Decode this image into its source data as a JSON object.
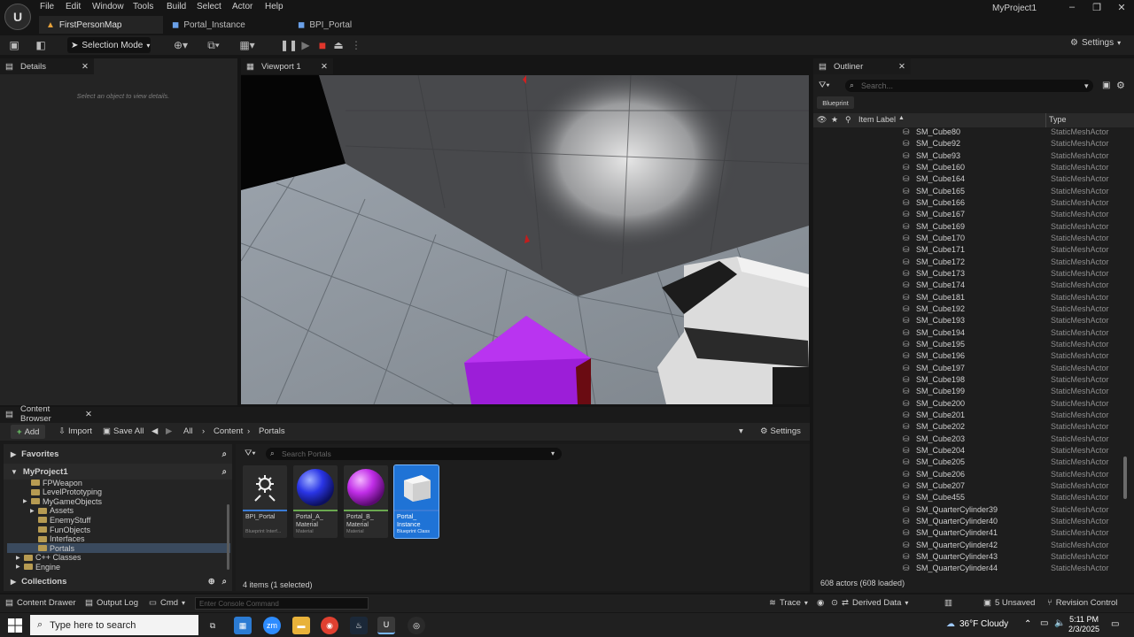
{
  "menu": [
    "File",
    "Edit",
    "Window",
    "Tools",
    "Build",
    "Select",
    "Actor",
    "Help"
  ],
  "project_name": "MyProject1",
  "document_tabs": [
    "FirstPersonMap",
    "Portal_Instance",
    "BPI_Portal"
  ],
  "toolbar": {
    "selection_mode": "Selection Mode",
    "settings": "Settings"
  },
  "details": {
    "tab": "Details",
    "empty_message": "Select an object to view details."
  },
  "viewport": {
    "tab": "Viewport 1"
  },
  "outliner": {
    "tab": "Outliner",
    "search_placeholder": "Search...",
    "filter_chip": "Blueprint",
    "col_label": "Item Label",
    "col_type": "Type",
    "rows": [
      {
        "label": "SM_Cube80",
        "type": "StaticMeshActor"
      },
      {
        "label": "SM_Cube92",
        "type": "StaticMeshActor"
      },
      {
        "label": "SM_Cube93",
        "type": "StaticMeshActor"
      },
      {
        "label": "SM_Cube160",
        "type": "StaticMeshActor"
      },
      {
        "label": "SM_Cube164",
        "type": "StaticMeshActor"
      },
      {
        "label": "SM_Cube165",
        "type": "StaticMeshActor"
      },
      {
        "label": "SM_Cube166",
        "type": "StaticMeshActor"
      },
      {
        "label": "SM_Cube167",
        "type": "StaticMeshActor"
      },
      {
        "label": "SM_Cube169",
        "type": "StaticMeshActor"
      },
      {
        "label": "SM_Cube170",
        "type": "StaticMeshActor"
      },
      {
        "label": "SM_Cube171",
        "type": "StaticMeshActor"
      },
      {
        "label": "SM_Cube172",
        "type": "StaticMeshActor"
      },
      {
        "label": "SM_Cube173",
        "type": "StaticMeshActor"
      },
      {
        "label": "SM_Cube174",
        "type": "StaticMeshActor"
      },
      {
        "label": "SM_Cube181",
        "type": "StaticMeshActor"
      },
      {
        "label": "SM_Cube192",
        "type": "StaticMeshActor"
      },
      {
        "label": "SM_Cube193",
        "type": "StaticMeshActor"
      },
      {
        "label": "SM_Cube194",
        "type": "StaticMeshActor"
      },
      {
        "label": "SM_Cube195",
        "type": "StaticMeshActor"
      },
      {
        "label": "SM_Cube196",
        "type": "StaticMeshActor"
      },
      {
        "label": "SM_Cube197",
        "type": "StaticMeshActor"
      },
      {
        "label": "SM_Cube198",
        "type": "StaticMeshActor"
      },
      {
        "label": "SM_Cube199",
        "type": "StaticMeshActor"
      },
      {
        "label": "SM_Cube200",
        "type": "StaticMeshActor"
      },
      {
        "label": "SM_Cube201",
        "type": "StaticMeshActor"
      },
      {
        "label": "SM_Cube202",
        "type": "StaticMeshActor"
      },
      {
        "label": "SM_Cube203",
        "type": "StaticMeshActor"
      },
      {
        "label": "SM_Cube204",
        "type": "StaticMeshActor"
      },
      {
        "label": "SM_Cube205",
        "type": "StaticMeshActor"
      },
      {
        "label": "SM_Cube206",
        "type": "StaticMeshActor"
      },
      {
        "label": "SM_Cube207",
        "type": "StaticMeshActor"
      },
      {
        "label": "SM_Cube455",
        "type": "StaticMeshActor"
      },
      {
        "label": "SM_QuarterCylinder39",
        "type": "StaticMeshActor"
      },
      {
        "label": "SM_QuarterCylinder40",
        "type": "StaticMeshActor"
      },
      {
        "label": "SM_QuarterCylinder41",
        "type": "StaticMeshActor"
      },
      {
        "label": "SM_QuarterCylinder42",
        "type": "StaticMeshActor"
      },
      {
        "label": "SM_QuarterCylinder43",
        "type": "StaticMeshActor"
      },
      {
        "label": "SM_QuarterCylinder44",
        "type": "StaticMeshActor"
      }
    ],
    "status": "608 actors (608 loaded)"
  },
  "content_browser": {
    "tab": "Content Browser",
    "add": "Add",
    "import": "Import",
    "save_all": "Save All",
    "breadcrumb": [
      "All",
      "Content",
      "Portals"
    ],
    "settings": "Settings",
    "favorites": "Favorites",
    "root": "MyProject1",
    "tree": [
      {
        "label": "FPWeapon",
        "indent": 1
      },
      {
        "label": "LevelPrototyping",
        "indent": 1
      },
      {
        "label": "MyGameObjects",
        "indent": 1
      },
      {
        "label": "Assets",
        "indent": 2
      },
      {
        "label": "EnemyStuff",
        "indent": 2
      },
      {
        "label": "FunObjects",
        "indent": 2
      },
      {
        "label": "Interfaces",
        "indent": 2
      },
      {
        "label": "Portals",
        "indent": 2
      },
      {
        "label": "C++ Classes",
        "indent": 0
      },
      {
        "label": "Engine",
        "indent": 0
      }
    ],
    "collections": "Collections",
    "search_placeholder": "Search Portals",
    "assets": [
      {
        "name": "BPI_Portal",
        "type": "Blueprint Interf...",
        "stripe": "#3a7bd5",
        "kind": "interface"
      },
      {
        "name": "Portal_A_ Material",
        "type": "Material",
        "stripe": "#6aa84f",
        "kind": "sphere-blue"
      },
      {
        "name": "Portal_B_ Material",
        "type": "Material",
        "stripe": "#6aa84f",
        "kind": "sphere-purple"
      },
      {
        "name": "Portal_ Instance",
        "type": "Blueprint Class",
        "stripe": "#3a7bd5",
        "kind": "blueprint"
      }
    ],
    "items_count": "4 items (1 selected)"
  },
  "statusbar": {
    "content_drawer": "Content Drawer",
    "output_log": "Output Log",
    "cmd": "Cmd",
    "console_placeholder": "Enter Console Command",
    "trace": "Trace",
    "derived_data": "Derived Data",
    "unsaved": "5 Unsaved",
    "revision_control": "Revision Control"
  },
  "taskbar": {
    "search_placeholder": "Type here to search",
    "weather": "36°F  Cloudy",
    "time": "5:11 PM",
    "date": "2/3/2025"
  }
}
